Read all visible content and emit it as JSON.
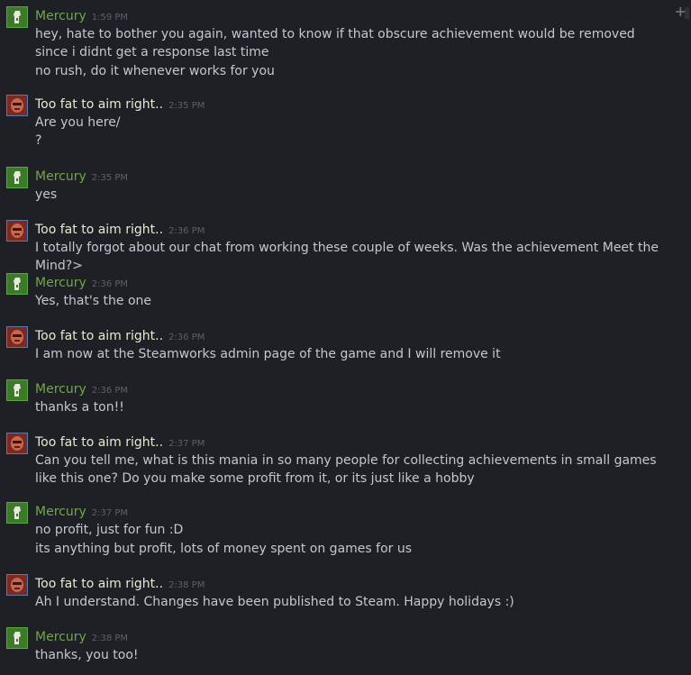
{
  "colors": {
    "background": "#1e2025",
    "mercury_name": "#6ea84a",
    "toofat_name": "#e4ecd2",
    "message_text": "#c4c8ce",
    "timestamp": "#5c6068"
  },
  "toolbar": {
    "add_icon": "plus-icon"
  },
  "messages": [
    {
      "sender": "Mercury",
      "time": "1:59 PM",
      "lines": [
        "hey, hate to bother you again, wanted to know if that obscure achievement would be removed since i didnt get a response last time",
        "no rush, do it whenever works for you"
      ]
    },
    {
      "sender": "Too fat to aim right..",
      "time": "2:35 PM",
      "lines": [
        "Are you here/",
        "?"
      ]
    },
    {
      "sender": "Mercury",
      "time": "2:35 PM",
      "lines": [
        "yes"
      ]
    },
    {
      "sender": "Too fat to aim right..",
      "time": "2:36 PM",
      "lines": [
        "I totally forgot about our chat from working these couple of weeks. Was the achievement Meet the Mind?>"
      ]
    },
    {
      "sender": "Mercury",
      "time": "2:36 PM",
      "lines": [
        "Yes, that's the one"
      ]
    },
    {
      "sender": "Too fat to aim right..",
      "time": "2:36 PM",
      "lines": [
        "I am now at the Steamworks admin page of the game and I will remove it"
      ]
    },
    {
      "sender": "Mercury",
      "time": "2:36 PM",
      "lines": [
        "thanks a ton!!"
      ]
    },
    {
      "sender": "Too fat to aim right..",
      "time": "2:37 PM",
      "lines": [
        "Can you tell me, what is this mania in so many people for collecting achievements in small games like this one? Do you make some profit from it, or its just like a hobby"
      ]
    },
    {
      "sender": "Mercury",
      "time": "2:37 PM",
      "lines": [
        "no profit, just for fun :D",
        "its anything but profit, lots of money spent on games for us"
      ]
    },
    {
      "sender": "Too fat to aim right..",
      "time": "2:38 PM",
      "lines": [
        "Ah I understand. Changes have been published to Steam. Happy holidays :)"
      ]
    },
    {
      "sender": "Mercury",
      "time": "2:38 PM",
      "lines": [
        "thanks, you too!"
      ]
    }
  ]
}
